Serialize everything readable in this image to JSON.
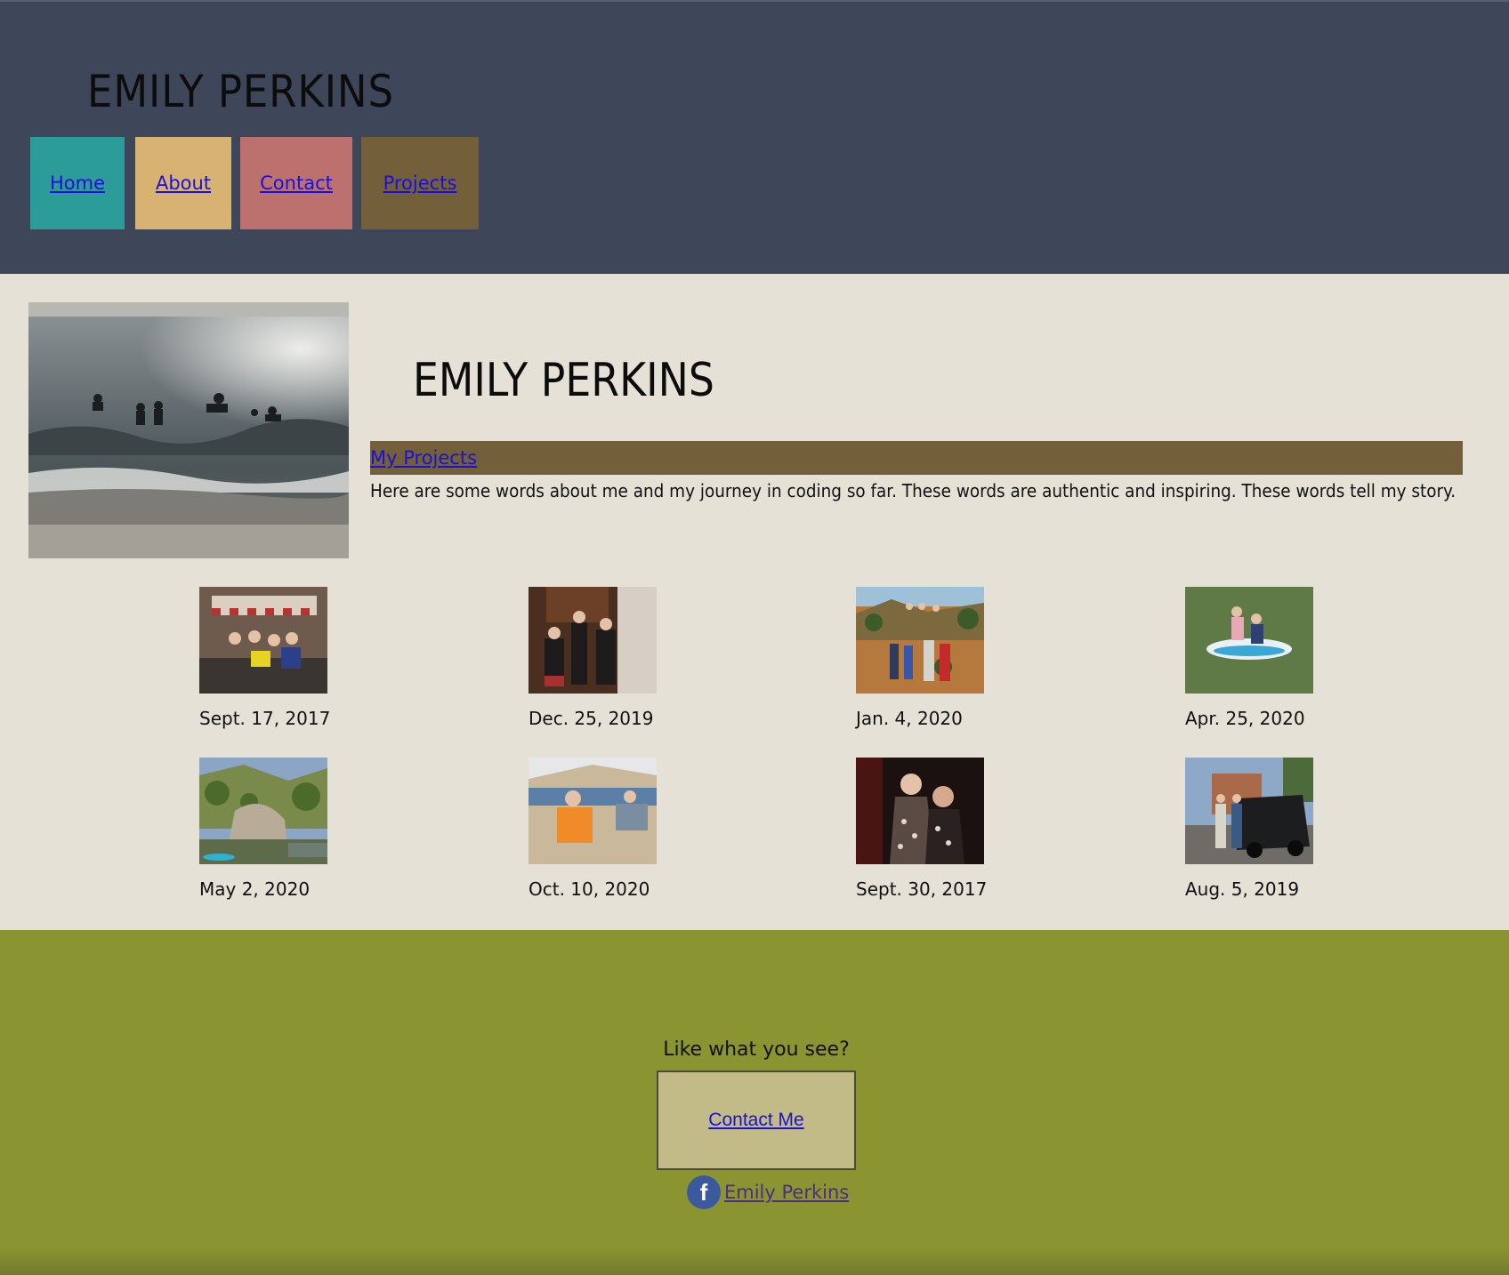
{
  "header": {
    "site_title": "EMILY PERKINS",
    "nav": [
      {
        "label": "Home"
      },
      {
        "label": "About"
      },
      {
        "label": "Contact"
      },
      {
        "label": "Projects"
      }
    ]
  },
  "main": {
    "name": "EMILY PERKINS",
    "projects_link": "My Projects",
    "bio": "Here are some words about me and my journey in coding so far. These words are authentic and inspiring. These words tell my story.",
    "gallery": [
      {
        "caption": "Sept. 17, 2017"
      },
      {
        "caption": "Dec. 25, 2019"
      },
      {
        "caption": "Jan. 4, 2020"
      },
      {
        "caption": "Apr. 25, 2020"
      },
      {
        "caption": "May 2, 2020"
      },
      {
        "caption": "Oct. 10, 2020"
      },
      {
        "caption": "Sept. 30, 2017"
      },
      {
        "caption": "Aug. 5, 2019"
      }
    ]
  },
  "footer": {
    "question": "Like what you see?",
    "contact_button": "Contact Me",
    "facebook_link": "Emily Perkins",
    "facebook_icon_glyph": "f"
  },
  "colors": {
    "header_bg": "#3e4659",
    "main_bg": "#e6e1d6",
    "footer_bg": "#8a9431",
    "nav_home": "#2b9c98",
    "nav_about": "#d8b273",
    "nav_contact": "#bd716f",
    "nav_projects": "#735f39",
    "link": "#1a10d8"
  }
}
